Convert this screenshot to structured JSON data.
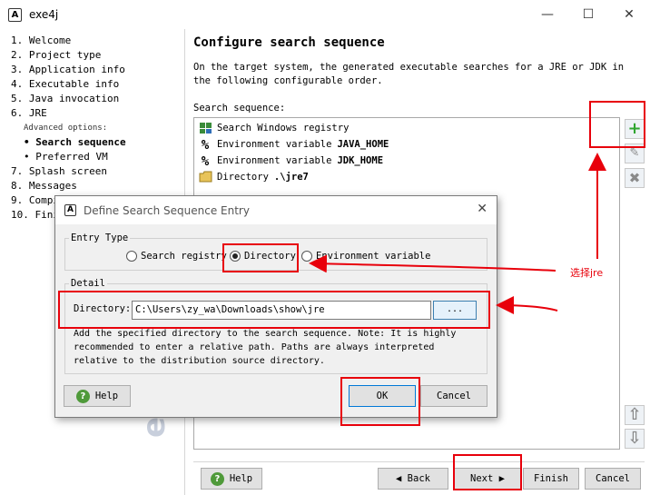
{
  "window": {
    "title": "exe4j",
    "minimize": "—",
    "maximize": "☐",
    "close": "✕",
    "logo": "A"
  },
  "sidebar": {
    "steps": [
      {
        "label": "1.  Welcome"
      },
      {
        "label": "2.  Project type"
      },
      {
        "label": "3.  Application info"
      },
      {
        "label": "4.  Executable info"
      },
      {
        "label": "5.  Java invocation"
      },
      {
        "label": "6.  JRE"
      },
      {
        "label": "Advanced options:"
      },
      {
        "label": "• Search sequence"
      },
      {
        "label": "• Preferred VM"
      },
      {
        "label": "7.  Splash screen"
      },
      {
        "label": "8.  Messages"
      },
      {
        "label": "9.  Compi"
      },
      {
        "label": "10. Fini"
      }
    ],
    "watermark": "exe4j"
  },
  "main": {
    "heading": "Configure search sequence",
    "description": "On the target system, the generated executable searches for a JRE or JDK in the following configurable order.",
    "search_label": "Search sequence:",
    "items": [
      {
        "prefix": "Search Windows registry",
        "value": ""
      },
      {
        "prefix": "Environment variable",
        "value": "JAVA_HOME"
      },
      {
        "prefix": "Environment variable",
        "value": "JDK_HOME"
      },
      {
        "prefix": "Directory",
        "value": ".\\jre7"
      }
    ],
    "tools": {
      "add": "+",
      "edit": "✎",
      "remove": "✖",
      "up": "⇧",
      "down": "⇩"
    }
  },
  "bottom": {
    "help": "Help",
    "back": "◀ Back",
    "next": "Next ▶",
    "finish": "Finish",
    "cancel": "Cancel",
    "help_icon": "?"
  },
  "dialog": {
    "title": "Define Search Sequence Entry",
    "close": "✕",
    "logo": "A",
    "entry_type_label": "Entry Type",
    "options": [
      {
        "label": "Search registry",
        "selected": false
      },
      {
        "label": "Directory",
        "selected": true
      },
      {
        "label": "Environment variable",
        "selected": false
      }
    ],
    "detail_label": "Detail",
    "directory_label": "Directory:",
    "directory_value": "C:\\Users\\zy_wa\\Downloads\\show\\jre",
    "browse": "...",
    "note": "Add the specified directory to the search sequence. Note: It is highly recommended to enter a relative path. Paths are always interpreted relative to the distribution source directory.",
    "help": "Help",
    "ok": "OK",
    "cancel": "Cancel",
    "help_icon": "?"
  },
  "annotation": {
    "text": "选择jre",
    "color": "#e8000b"
  }
}
